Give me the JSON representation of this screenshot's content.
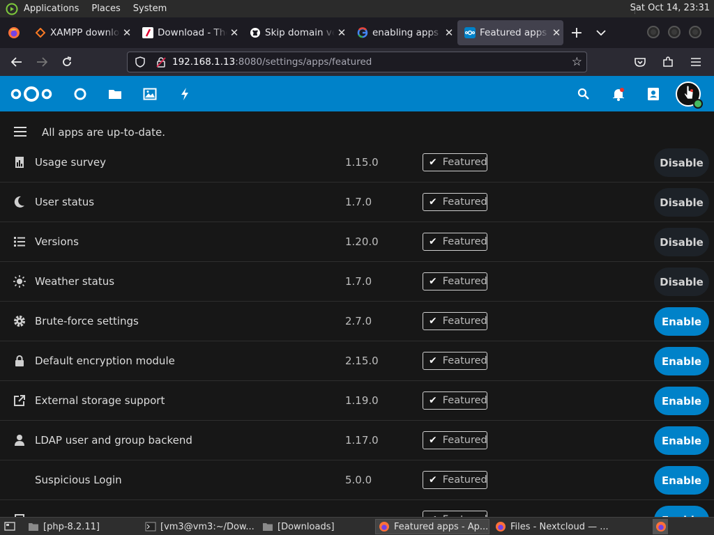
{
  "top_panel": {
    "menus": [
      "Applications",
      "Places",
      "System"
    ],
    "clock": "Sat Oct 14, 23:31"
  },
  "tabs": [
    {
      "label": "XAMPP download",
      "icon": "xampp-icon",
      "color": "#fb7a24"
    },
    {
      "label": "Download - The",
      "icon": "download-site-icon",
      "color": "#e0002e"
    },
    {
      "label": "Skip domain veri",
      "icon": "github-icon",
      "color": "#ffffff"
    },
    {
      "label": "enabling apps si",
      "icon": "google-icon",
      "color": "#4285f4"
    },
    {
      "label": "Featured apps -",
      "icon": "nextcloud-icon",
      "color": "#0082c9"
    }
  ],
  "url": {
    "host": "192.168.1.13",
    "path": ":8080/settings/apps/featured"
  },
  "status": {
    "message": "All apps are up-to-date."
  },
  "badge_label": "Featured",
  "apps": [
    {
      "name": "Usage survey",
      "version": "1.15.0",
      "action": "Disable",
      "icon": "chart-icon"
    },
    {
      "name": "User status",
      "version": "1.7.0",
      "action": "Disable",
      "icon": "moon-icon"
    },
    {
      "name": "Versions",
      "version": "1.20.0",
      "action": "Disable",
      "icon": "list-icon"
    },
    {
      "name": "Weather status",
      "version": "1.7.0",
      "action": "Disable",
      "icon": "sun-icon"
    },
    {
      "name": "Brute-force settings",
      "version": "2.7.0",
      "action": "Enable",
      "icon": "gear-icon"
    },
    {
      "name": "Default encryption module",
      "version": "2.15.0",
      "action": "Enable",
      "icon": "lock-icon"
    },
    {
      "name": "External storage support",
      "version": "1.19.0",
      "action": "Enable",
      "icon": "external-link-icon"
    },
    {
      "name": "LDAP user and group backend",
      "version": "1.17.0",
      "action": "Enable",
      "icon": "user-icon"
    },
    {
      "name": "Suspicious Login",
      "version": "5.0.0",
      "action": "Enable",
      "icon": "blank-icon"
    },
    {
      "name": "",
      "version": "",
      "action": "Enable",
      "icon": "partial-icon"
    }
  ],
  "colors": {
    "nextcloud_primary": "#0082c9",
    "background": "#171717",
    "online_status": "#46ba61"
  },
  "taskbar": [
    {
      "label": "[php-8.2.11]",
      "icon": "folder-icon"
    },
    {
      "label": "[vm3@vm3:~/Dow...",
      "icon": "terminal-icon"
    },
    {
      "label": "[Downloads]",
      "icon": "folder-icon"
    },
    {
      "label": "Featured apps - Ap...",
      "icon": "firefox-icon",
      "active": true
    },
    {
      "label": "Files - Nextcloud — ...",
      "icon": "firefox-icon"
    }
  ]
}
